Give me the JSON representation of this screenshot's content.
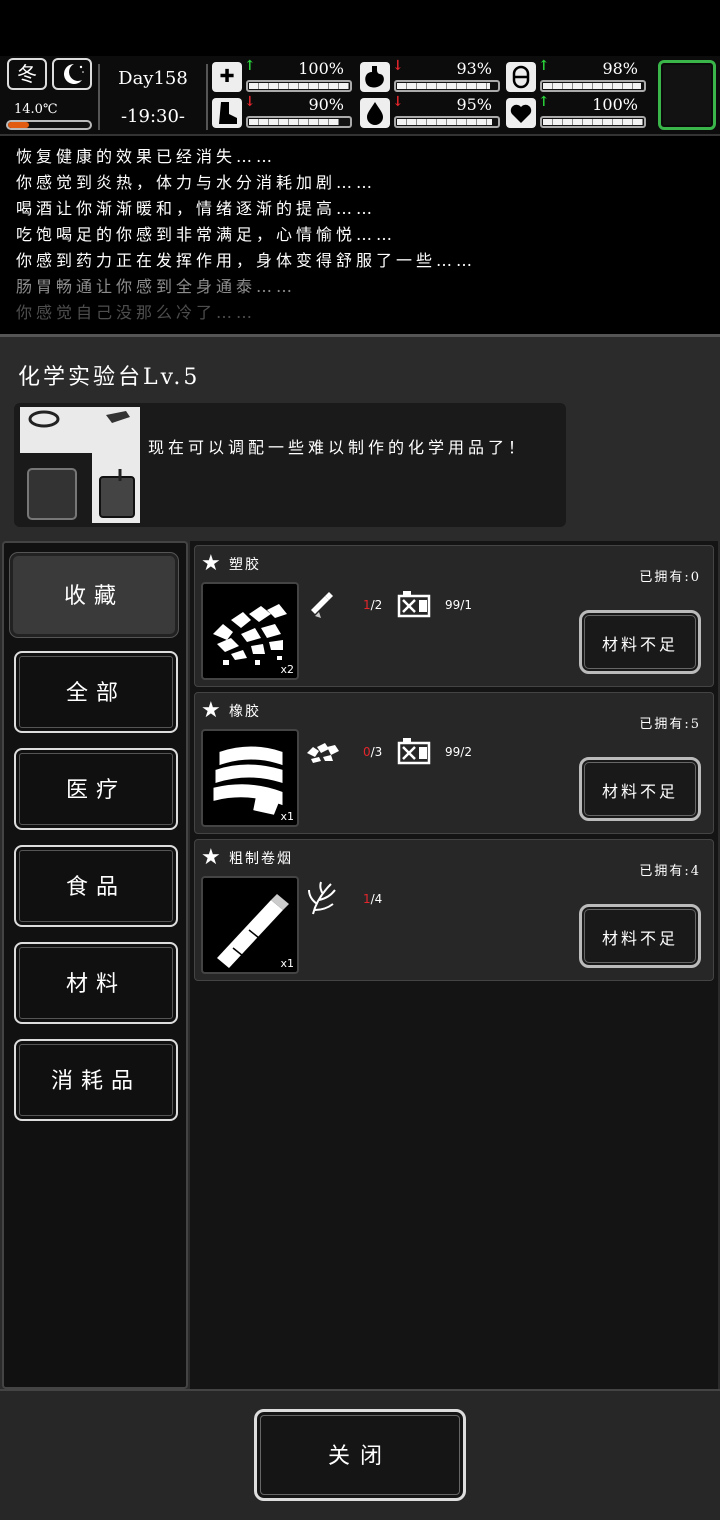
{
  "status": {
    "season": "冬",
    "weather_icon": "moon-icon",
    "temperature": "14.0℃",
    "temperature_level": 0.25,
    "day": "Day158",
    "time": "-19:30-",
    "stats": [
      {
        "name": "health",
        "icon": "medkit-icon",
        "trend": "up",
        "value": "100%",
        "level": 1.0
      },
      {
        "name": "hunger",
        "icon": "stomach-icon",
        "trend": "down",
        "value": "93%",
        "level": 0.93
      },
      {
        "name": "medicine",
        "icon": "pill-icon",
        "trend": "up",
        "value": "98%",
        "level": 0.98
      },
      {
        "name": "stamina",
        "icon": "boot-icon",
        "trend": "down",
        "value": "90%",
        "level": 0.9
      },
      {
        "name": "thirst",
        "icon": "water-drop-icon",
        "trend": "down",
        "value": "95%",
        "level": 0.95
      },
      {
        "name": "mood",
        "icon": "heart-icon",
        "trend": "up",
        "value": "100%",
        "level": 1.0
      }
    ],
    "accent_green": "#3ab54a",
    "accent_red": "#e3262c"
  },
  "log": [
    {
      "text": "恢复健康的效果已经消失……",
      "opacity": 1.0
    },
    {
      "text": "你感觉到炎热，体力与水分消耗加剧……",
      "opacity": 1.0
    },
    {
      "text": "喝酒让你渐渐暖和，情绪逐渐的提高……",
      "opacity": 1.0
    },
    {
      "text": "吃饱喝足的你感到非常满足，心情愉悦……",
      "opacity": 1.0
    },
    {
      "text": "你感到药力正在发挥作用，身体变得舒服了一些……",
      "opacity": 1.0
    },
    {
      "text": "肠胃畅通让你感到全身通泰……",
      "opacity": 0.55
    },
    {
      "text": "你感觉自己没那么冷了……",
      "opacity": 0.3
    }
  ],
  "station": {
    "title": "化学实验台Lv.5",
    "description": "现在可以调配一些难以制作的化学用品了！"
  },
  "sidebar": {
    "items": [
      {
        "label": "收藏",
        "active": true
      },
      {
        "label": "全部",
        "active": false
      },
      {
        "label": "医疗",
        "active": false
      },
      {
        "label": "食品",
        "active": false
      },
      {
        "label": "材料",
        "active": false
      },
      {
        "label": "消耗品",
        "active": false
      }
    ]
  },
  "recipes": [
    {
      "name": "塑胶",
      "output_qty": "x2",
      "owned": "已拥有:0",
      "materials": [
        {
          "icon": "plastic-bottle-icon",
          "have": "1",
          "need": "/2"
        },
        {
          "icon": "fuel-can-icon",
          "have": "",
          "need": "99/1"
        }
      ],
      "button": "材料不足"
    },
    {
      "name": "橡胶",
      "output_qty": "x1",
      "owned": "已拥有:5",
      "materials": [
        {
          "icon": "plastic-scraps-icon",
          "have": "0",
          "need": "/3"
        },
        {
          "icon": "fuel-can-icon",
          "have": "",
          "need": "99/2"
        }
      ],
      "button": "材料不足"
    },
    {
      "name": "粗制卷烟",
      "output_qty": "x1",
      "owned": "已拥有:4",
      "materials": [
        {
          "icon": "tobacco-leaf-icon",
          "have": "1",
          "need": "/4"
        }
      ],
      "button": "材料不足"
    }
  ],
  "footer": {
    "close_label": "关闭"
  }
}
